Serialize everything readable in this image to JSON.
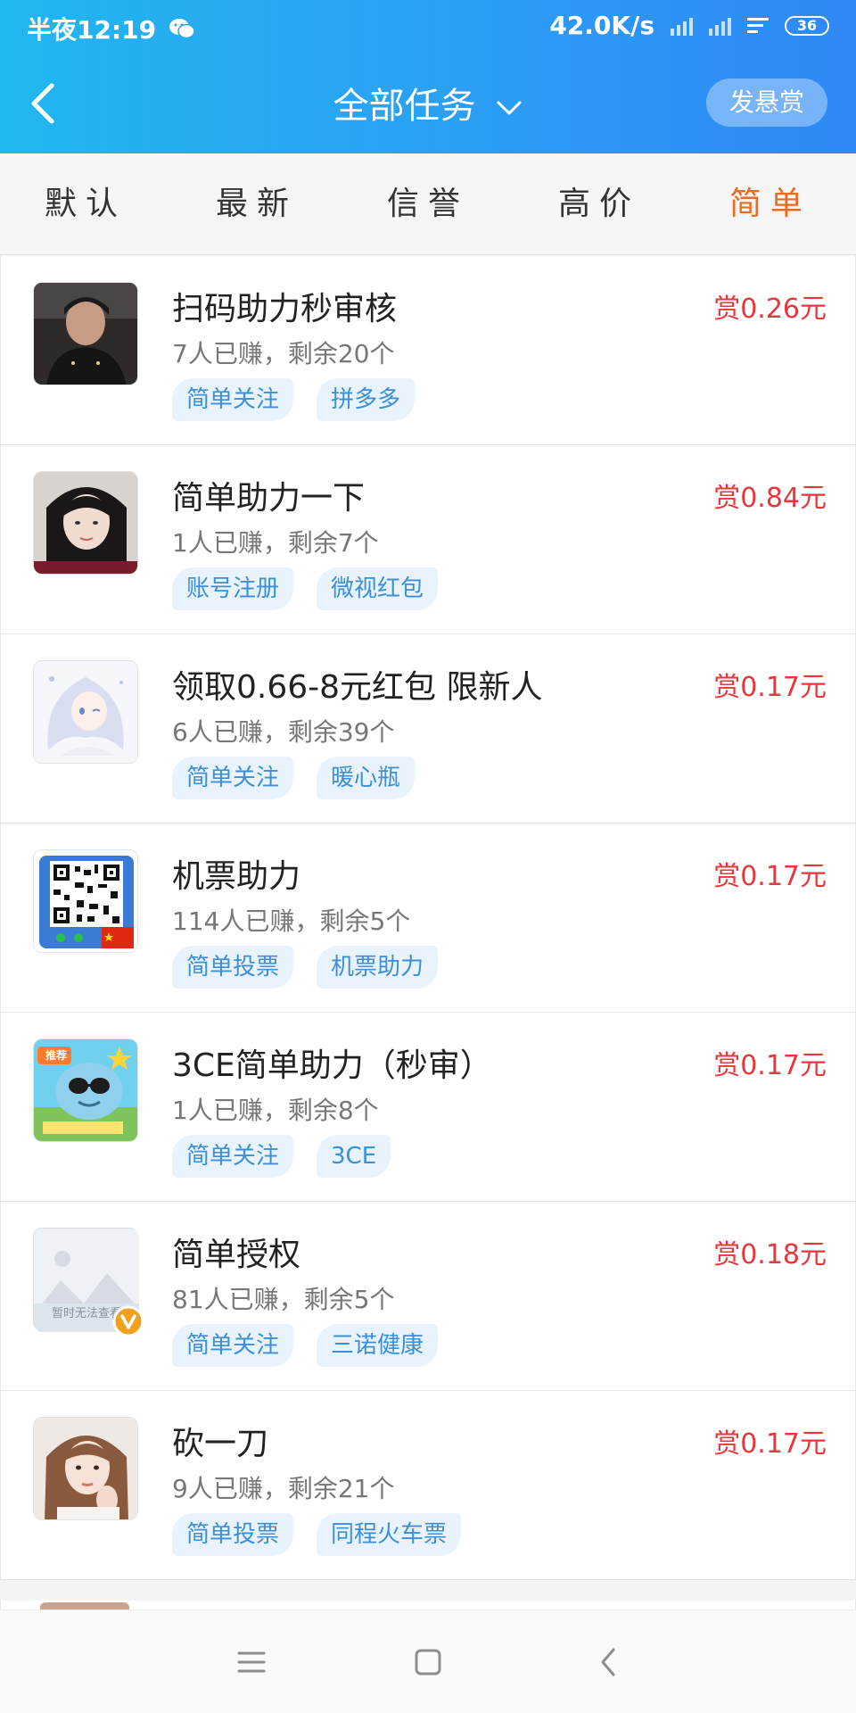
{
  "status_bar": {
    "time": "半夜12:19",
    "net_speed": "42.0K/s",
    "battery": "36"
  },
  "header": {
    "title": "全部任务",
    "reward_button": "发悬赏"
  },
  "tabs": [
    {
      "label": "默认",
      "active": false
    },
    {
      "label": "最新",
      "active": false
    },
    {
      "label": "信誉",
      "active": false
    },
    {
      "label": "高价",
      "active": false
    },
    {
      "label": "简单",
      "active": true
    }
  ],
  "tasks": [
    {
      "title": "扫码助力秒审核",
      "stats": "7人已赚，剩余20个",
      "price": "赏0.26元",
      "tags": [
        "简单关注",
        "拼多多"
      ],
      "avatar": "avatar-man-dark"
    },
    {
      "title": "简单助力一下",
      "stats": "1人已赚，剩余7个",
      "price": "赏0.84元",
      "tags": [
        "账号注册",
        "微视红包"
      ],
      "avatar": "avatar-girl-portrait"
    },
    {
      "title": "领取0.66-8元红包  限新人",
      "stats": "6人已赚，剩余39个",
      "price": "赏0.17元",
      "tags": [
        "简单关注",
        "暖心瓶"
      ],
      "avatar": "avatar-anime-girl"
    },
    {
      "title": "机票助力",
      "stats": "114人已赚，剩余5个",
      "price": "赏0.17元",
      "tags": [
        "简单投票",
        "机票助力"
      ],
      "avatar": "avatar-qr-code"
    },
    {
      "title": "3CE简单助力（秒审）",
      "stats": "1人已赚，剩余8个",
      "price": "赏0.17元",
      "tags": [
        "简单关注",
        "3CE"
      ],
      "avatar": "avatar-cartoon-character"
    },
    {
      "title": "简单授权",
      "stats": "81人已赚，剩余5个",
      "price": "赏0.18元",
      "tags": [
        "简单关注",
        "三诺健康"
      ],
      "avatar": "avatar-placeholder-image"
    },
    {
      "title": "砍一刀",
      "stats": "9人已赚，剩余21个",
      "price": "赏0.17元",
      "tags": [
        "简单投票",
        "同程火车票"
      ],
      "avatar": "avatar-girl-selfie"
    }
  ],
  "avatar_labels": {
    "promo_badge": "推荐",
    "placeholder_text": "暂时无法查看"
  },
  "colors": {
    "header_gradient_start": "#21b7ef",
    "header_gradient_end": "#2f88f6",
    "active_tab": "#ef6a21",
    "price": "#e5383b",
    "tag_bg": "#e9f3fd",
    "tag_text": "#3c8fd9"
  }
}
